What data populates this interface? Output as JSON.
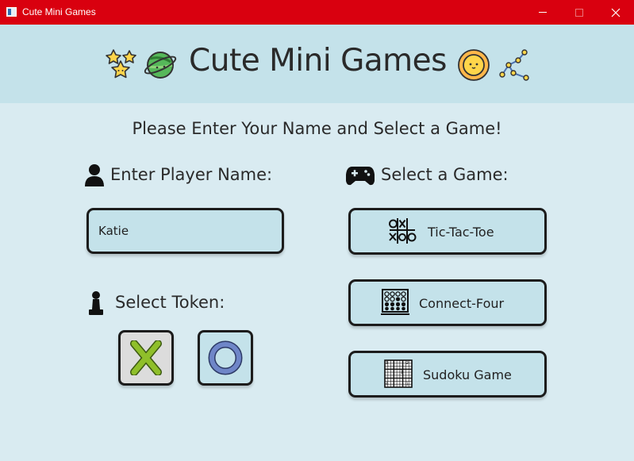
{
  "window": {
    "title": "Cute Mini Games",
    "controls": {
      "minimize_icon": "minimize-icon",
      "maximize_icon": "maximize-icon",
      "close_icon": "close-icon"
    }
  },
  "header": {
    "title": "Cute Mini Games",
    "left_icons": [
      "stars-icon",
      "planet-icon"
    ],
    "right_icons": [
      "sun-icon",
      "constellation-icon"
    ]
  },
  "instruction": "Please Enter Your Name and Select a Game!",
  "player": {
    "label": "Enter Player Name:",
    "icon": "user-icon",
    "name_value": "Katie"
  },
  "token": {
    "label": "Select Token:",
    "icon": "pawn-icon",
    "options": [
      "X",
      "O"
    ],
    "selected": "X"
  },
  "games": {
    "label": "Select a Game:",
    "icon": "gamepad-icon",
    "items": [
      {
        "label": "Tic-Tac-Toe",
        "icon": "tic-tac-toe-icon"
      },
      {
        "label": "Connect-Four",
        "icon": "connect-four-icon"
      },
      {
        "label": "Sudoku Game",
        "icon": "sudoku-icon"
      }
    ]
  },
  "colors": {
    "titlebar": "#d9000f",
    "header_bg": "#c4e2ea",
    "body_bg": "#d9ebf1",
    "button_bg": "#c4e2ea",
    "selected_token_bg": "#dcdcdc",
    "x_token": "#8fbf2a",
    "o_token": "#6f86c8"
  }
}
